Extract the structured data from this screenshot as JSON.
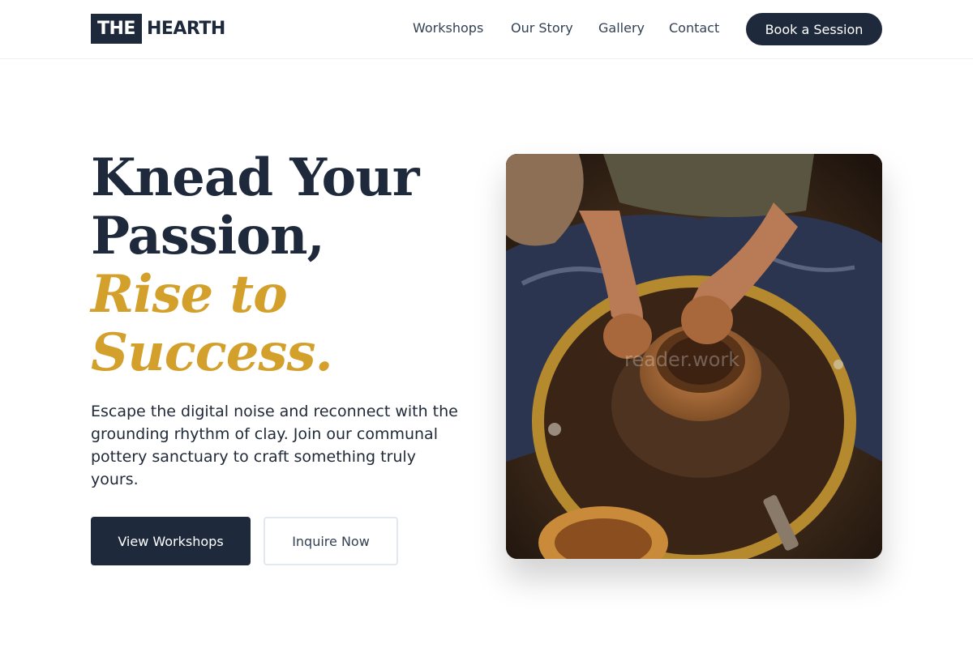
{
  "brand": {
    "logo_box": "THE",
    "logo_text": "HEARTH"
  },
  "nav": {
    "items": [
      "Workshops",
      "Our Story",
      "Gallery",
      "Contact"
    ],
    "cta": "Book a Session"
  },
  "hero": {
    "headline_line1": "Knead Your",
    "headline_line2": "Passion,",
    "headline_accent1": "Rise to",
    "headline_accent2": "Success.",
    "subtext": "Escape the digital noise and reconnect with the grounding rhythm of clay. Join our communal pottery sanctuary to craft something truly yours.",
    "primary_button": "View Workshops",
    "secondary_button": "Inquire Now",
    "image_watermark": "reader.work"
  },
  "colors": {
    "navy": "#1e293b",
    "accent_gold": "#d4a02c",
    "background": "#ffffff"
  }
}
